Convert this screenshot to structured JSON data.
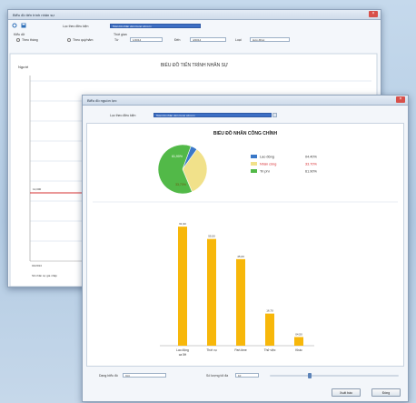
{
  "back_window": {
    "title": "Biểu đồ tiến trình nhân sự",
    "toolbar": {
      "field1_label": "Lọc theo điều kiện",
      "field1_value": "Toàn bộ nhân viên trong công ty",
      "group_label": "Kiểu dữ",
      "radio1": "Theo tháng",
      "radio2": "Theo quý/năm",
      "period_label": "Thời gian",
      "from_label": "Từ",
      "from_value": "1/2014",
      "to_label": "Đến",
      "to_value": "4/2014",
      "kind_label": "Loại",
      "kind_value": "Hợp đồng"
    },
    "chart": {
      "title": "BIỂU ĐỒ TIẾN TRÌNH NHÂN SỰ",
      "ylabel": "Người",
      "red_line_label": "12,000",
      "x_tick": "01/2014",
      "x_caption": "Số nhân sự gia nhập"
    }
  },
  "front_window": {
    "title": "Biểu đồ nguồn lực",
    "filter_label": "Lọc theo điều kiện",
    "filter_value": "Toàn bộ nhân viên trong công ty",
    "bottom": {
      "type_label": "Dạng biểu đồ",
      "type_value": "Cột",
      "threshold_label": "Số lượng tối đa",
      "threshold_value": "10"
    },
    "buttons": {
      "export": "Xuất báo",
      "close": "Đóng"
    }
  },
  "chart_data": [
    {
      "type": "pie",
      "title": "BIỂU ĐỒ NHÂN CÔNG CHÍNH",
      "slices": [
        {
          "name": "Lao động",
          "value": 4.4,
          "label": "04.40%",
          "color": "#3a78c8"
        },
        {
          "name": "Nhân công",
          "value": 33.7,
          "label": "33.70%",
          "color": "#f1e18a"
        },
        {
          "name": "Tri phí",
          "value": 61.9,
          "label": "61.90%",
          "color": "#52b948"
        }
      ],
      "slice_labels": [
        "61,90%",
        "33,70%"
      ],
      "legend_placement": "right"
    },
    {
      "type": "bar",
      "categories": [
        "Lao động ca 5H",
        "Thời vụ",
        "Part-time",
        "Thử việc",
        "Khác"
      ],
      "values": [
        61.9,
        55.5,
        45.0,
        16.7,
        4.5
      ],
      "data_labels": [
        "61,90",
        "55,50",
        "45,00",
        "16,70",
        "04,50"
      ],
      "ylim": [
        0,
        70
      ],
      "color": "#f7b70a",
      "grid": false
    }
  ]
}
